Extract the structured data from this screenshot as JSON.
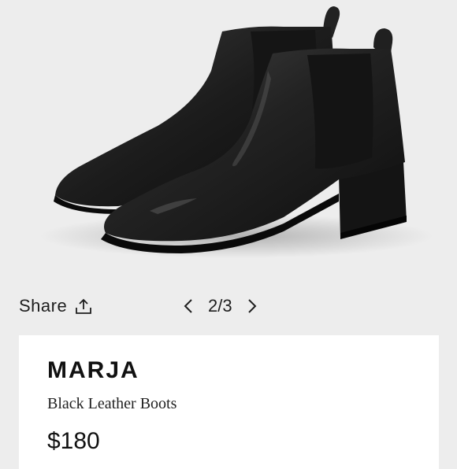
{
  "colors": {
    "background": "#ededed",
    "card": "#ffffff",
    "text": "#1e1e1e",
    "boot": "#1b1b1b"
  },
  "controls": {
    "share_label": "Share",
    "share_icon": "share-upload-icon",
    "pager": {
      "prev_icon": "chevron-left-icon",
      "current": "2/3",
      "next_icon": "chevron-right-icon"
    }
  },
  "product": {
    "brand": "MARJA",
    "description": "Black Leather Boots",
    "price": "$180"
  }
}
